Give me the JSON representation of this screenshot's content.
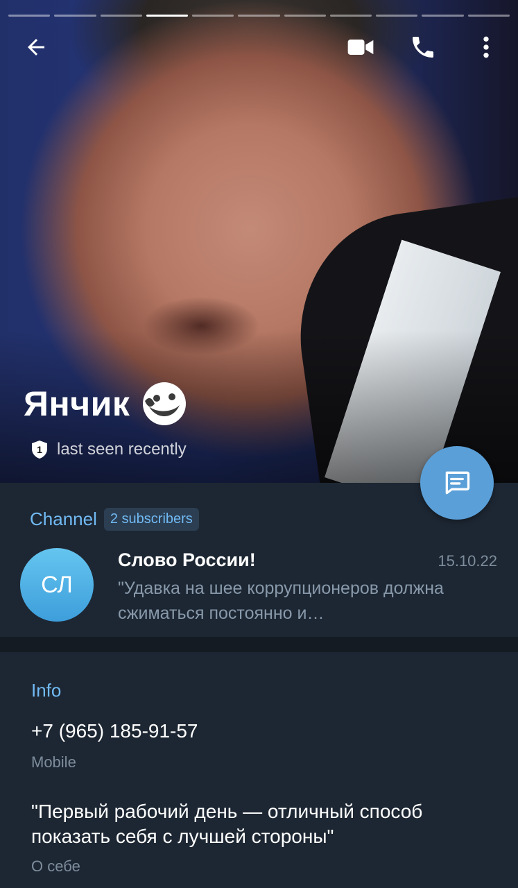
{
  "story": {
    "total": 11,
    "active_index": 3
  },
  "header": {
    "name": "Янчик",
    "status_badge": "1",
    "status": "last seen recently"
  },
  "icons": {
    "back": "arrow-left-icon",
    "video": "video-camera-icon",
    "phone": "phone-icon",
    "menu": "more-vertical-icon",
    "emoji_status": "emoji-status-icon",
    "fab": "message-icon"
  },
  "channel": {
    "section_label": "Channel",
    "subscribers": "2 subscribers",
    "avatar_initials": "СЛ",
    "name": "Слово России!",
    "date": "15.10.22",
    "preview": "\"Удавка на шее коррупционеров должна сжиматься постоянно и…"
  },
  "info": {
    "title": "Info",
    "phone": "+7 (965) 185-91-57",
    "phone_label": "Mobile",
    "bio": "\"Первый рабочий день — отличный способ показать себя с лучшей стороны\"",
    "bio_label": "О себе"
  },
  "colors": {
    "accent": "#71baf4",
    "background": "#1d2733",
    "fab": "#5a9fd8",
    "avatar": "#4fb0e6"
  }
}
